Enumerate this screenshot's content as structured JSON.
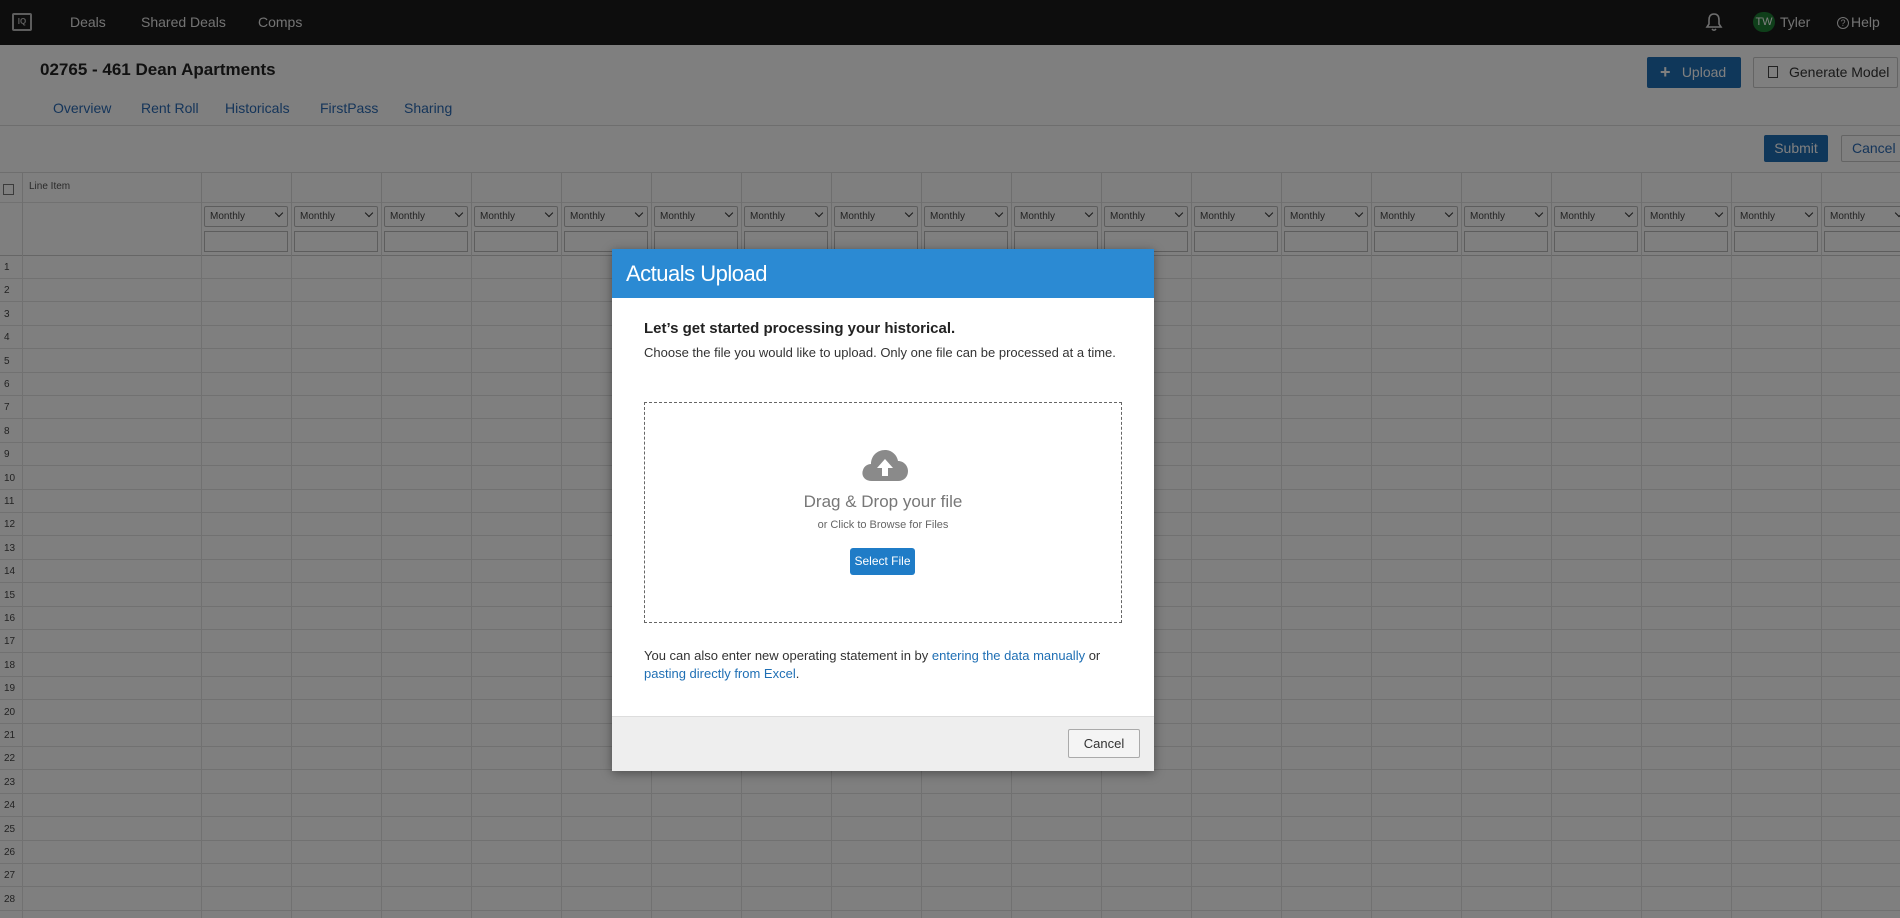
{
  "topnav": {
    "logo_text": "IQ",
    "links": [
      "Deals",
      "Shared Deals",
      "Comps"
    ],
    "user_initials": "TW",
    "user_name": "Tyler",
    "help_label": "Help"
  },
  "page": {
    "title": "02765 - 461 Dean Apartments",
    "tabs": [
      "Overview",
      "Rent Roll",
      "Historicals",
      "FirstPass",
      "Sharing"
    ],
    "upload_label": "Upload",
    "generate_model_label": "Generate Model",
    "submit_label": "Submit",
    "cancel_label": "Cancel"
  },
  "grid": {
    "line_item_header": "Line Item",
    "period_option": "Monthly",
    "row_numbers": [
      "1",
      "2",
      "3",
      "4",
      "5",
      "6",
      "7",
      "8",
      "9",
      "10",
      "11",
      "12",
      "13",
      "14",
      "15",
      "16",
      "17",
      "18",
      "19",
      "20",
      "21",
      "22",
      "23",
      "24",
      "25",
      "26",
      "27",
      "28"
    ]
  },
  "modal": {
    "title": "Actuals Upload",
    "heading": "Let’s get started processing your historical.",
    "subtext": "Choose the file you would like to upload. Only one file can be processed at a time.",
    "drop_title": "Drag & Drop your file",
    "drop_sub": "or Click to Browse for Files",
    "select_file_label": "Select File",
    "note_prefix": "You can also enter new operating statement in by ",
    "manual_link": "entering the data manually",
    "note_middle": " or ",
    "excel_link": "pasting directly from Excel",
    "note_suffix": ".",
    "cancel_label": "Cancel"
  },
  "colors": {
    "topbar": "#1a1a1a",
    "primary": "#1f6fb4",
    "modal_header": "#2b8ad3",
    "link": "#2a6ab5"
  }
}
